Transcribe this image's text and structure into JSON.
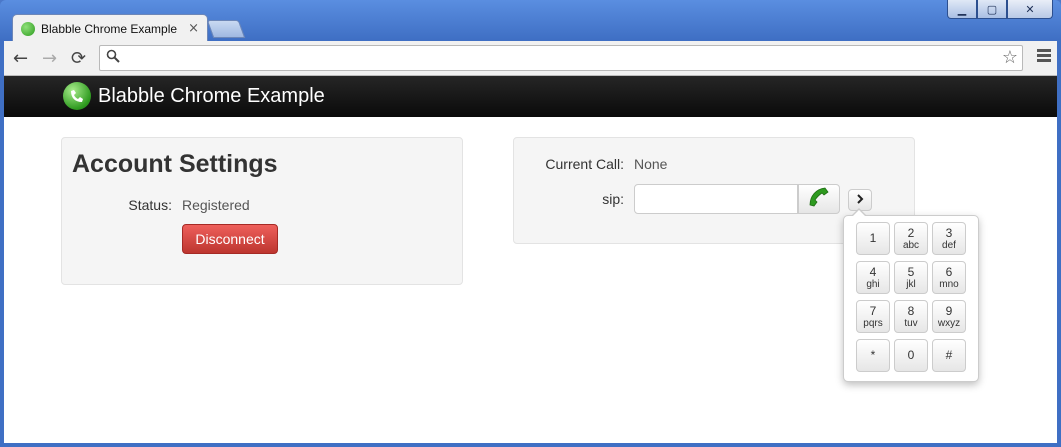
{
  "browser": {
    "tab_title": "Blabble Chrome Example",
    "tab_close": "×",
    "window_controls": {
      "minimize": "▁",
      "maximize": "▢",
      "close": "✕"
    },
    "toolbar": {
      "back": "←",
      "forward": "→",
      "reload": "⟳",
      "star": "☆",
      "search": "⚲"
    },
    "omnibox": {
      "value": "",
      "placeholder": ""
    }
  },
  "app": {
    "brand": "Blabble Chrome Example",
    "account": {
      "title": "Account Settings",
      "status_label": "Status:",
      "status_value": "Registered",
      "disconnect_label": "Disconnect"
    },
    "call": {
      "current_call_label": "Current Call:",
      "current_call_value": "None",
      "sip_label": "sip:",
      "sip_value": "",
      "toggle_label": "›"
    },
    "dialpad": {
      "keys": [
        {
          "digit": "1",
          "letters": ""
        },
        {
          "digit": "2",
          "letters": "abc"
        },
        {
          "digit": "3",
          "letters": "def"
        },
        {
          "digit": "4",
          "letters": "ghi"
        },
        {
          "digit": "5",
          "letters": "jkl"
        },
        {
          "digit": "6",
          "letters": "mno"
        },
        {
          "digit": "7",
          "letters": "pqrs"
        },
        {
          "digit": "8",
          "letters": "tuv"
        },
        {
          "digit": "9",
          "letters": "wxyz"
        },
        {
          "digit": "*",
          "letters": ""
        },
        {
          "digit": "0",
          "letters": ""
        },
        {
          "digit": "#",
          "letters": ""
        }
      ]
    }
  },
  "colors": {
    "navbar": "#111111",
    "danger_button": "#d9534f",
    "phone_green": "#2e9a1f"
  }
}
